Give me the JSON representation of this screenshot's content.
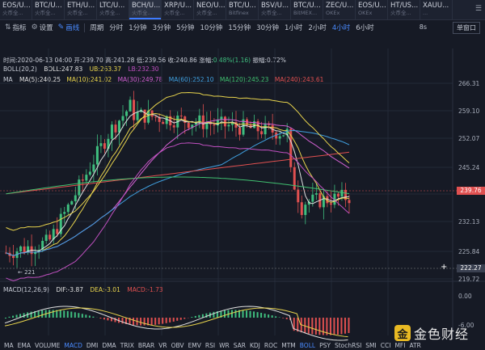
{
  "tabs": [
    {
      "name": "EOS/U...",
      "sub": "火币全..."
    },
    {
      "name": "BTC/U...",
      "sub": "火币全..."
    },
    {
      "name": "ETH/U...",
      "sub": "火币全..."
    },
    {
      "name": "LTC/U...",
      "sub": "火币全..."
    },
    {
      "name": "BCH/U...",
      "sub": "火币全..."
    },
    {
      "name": "XRP/U...",
      "sub": "火币全..."
    },
    {
      "name": "NEO/U...",
      "sub": "火币全..."
    },
    {
      "name": "BTC/U...",
      "sub": "Bitfinex"
    },
    {
      "name": "BSV/U...",
      "sub": "火币全..."
    },
    {
      "name": "BTC/U...",
      "sub": "BitMEX..."
    },
    {
      "name": "ZEC/U...",
      "sub": "OKEx"
    },
    {
      "name": "EOS/U...",
      "sub": "OKEx"
    },
    {
      "name": "HT/US...",
      "sub": "火币全..."
    },
    {
      "name": "XAUU...",
      "sub": "..."
    }
  ],
  "active_tab": 4,
  "tabs_more": "☰",
  "toolbar": {
    "indicator": "指标",
    "settings": "设置",
    "draw": "画线",
    "period": "周期",
    "intervals": [
      "分时",
      "1分钟",
      "3分钟",
      "5分钟",
      "10分钟",
      "15分钟",
      "30分钟",
      "1小时",
      "2小时",
      "4小时",
      "6小时"
    ],
    "active_interval": "4小时",
    "speed": "8s",
    "window": "单窗口"
  },
  "info": {
    "time": "时间:2020-06-13 04:00",
    "open": "开:239.70",
    "high": "高:241.28",
    "low": "低:239.56",
    "close": "收:240.86",
    "change_label": "涨幅:",
    "change": "0.48%(1.16)",
    "amplitude": "振幅:0.72%"
  },
  "boll": {
    "label": "BOLL(20,2)",
    "boll": "BOLL:247.83",
    "ub": "UB:263.37",
    "lb": "LB:232.30"
  },
  "ma": {
    "label": "MA",
    "ma5": "MA(5):240.25",
    "ma10": "MA(10):241.02",
    "ma30": "MA(30):249.78",
    "ma60": "MA(60):252.10",
    "ma120": "MA(120):245.23",
    "ma240": "MA(240):243.61"
  },
  "macd": {
    "label": "MACD(12,26,9)",
    "dif": "DIF:-3.87",
    "dea": "DEA:-3.01",
    "macd": "MACD:-1.73"
  },
  "y_axis": [
    "266.31",
    "259.10",
    "252.07",
    "245.24",
    "239.76",
    "232.13",
    "225.84",
    "222.27",
    "219.72"
  ],
  "current_price": "239.76",
  "crosshair_price": "222.27",
  "low_marker": "← 221",
  "plus": "+",
  "macd_axis": [
    "0.00",
    "-6.00"
  ],
  "indicators": [
    "MA",
    "EMA",
    "VOLUME",
    "MACD",
    "DMI",
    "DMA",
    "TRIX",
    "BRAR",
    "VR",
    "OBV",
    "EMV",
    "RSI",
    "WR",
    "SAR",
    "KDJ",
    "ROC",
    "MTM",
    "BOLL",
    "PSY",
    "StochRSI",
    "SMI",
    "CCI",
    "MFI",
    "ATR"
  ],
  "active_indicators": [
    "MACD",
    "BOLL"
  ],
  "logo_text": "金色财经",
  "colors": {
    "up": "#3fbf7f",
    "down": "#e05050",
    "boll_mid": "#e0e0e0",
    "ub": "#e8d44d",
    "lb": "#c050c0",
    "ma5": "#e0e0e0",
    "ma10": "#e8d44d",
    "ma30": "#d060d0",
    "ma60": "#40a0e0",
    "ma120": "#40c070",
    "ma240": "#e05050"
  }
}
